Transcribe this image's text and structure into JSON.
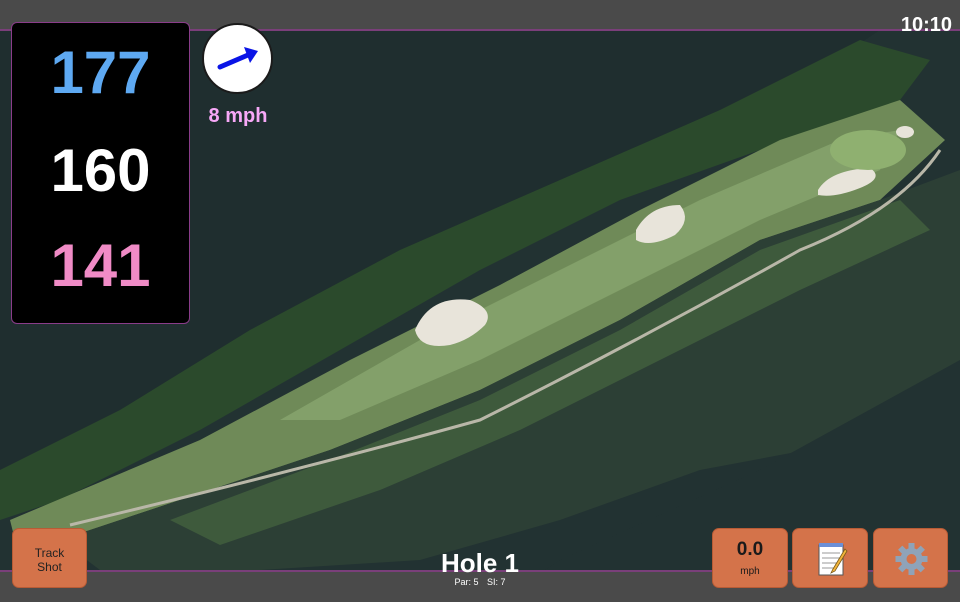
{
  "clock": {
    "time": "10:10"
  },
  "distances": {
    "back": "177",
    "middle": "160",
    "front": "141"
  },
  "wind": {
    "speed": "8 mph",
    "icon": "wind-arrow-icon",
    "arrow_color": "#0a14e6"
  },
  "buttons": {
    "track_shot_line1": "Track",
    "track_shot_line2": "Shot",
    "speed_value": "0.0",
    "speed_unit": "mph",
    "notes_icon": "notepad-icon",
    "settings_icon": "gear-icon"
  },
  "hole": {
    "title": "Hole 1",
    "par": "Par: 5",
    "si": "SI: 7"
  },
  "colors": {
    "back_distance": "#5ea9f2",
    "middle_distance": "#ffffff",
    "front_distance": "#f08bc6",
    "button": "#d4734a",
    "accent_border": "#7a3f7a"
  }
}
